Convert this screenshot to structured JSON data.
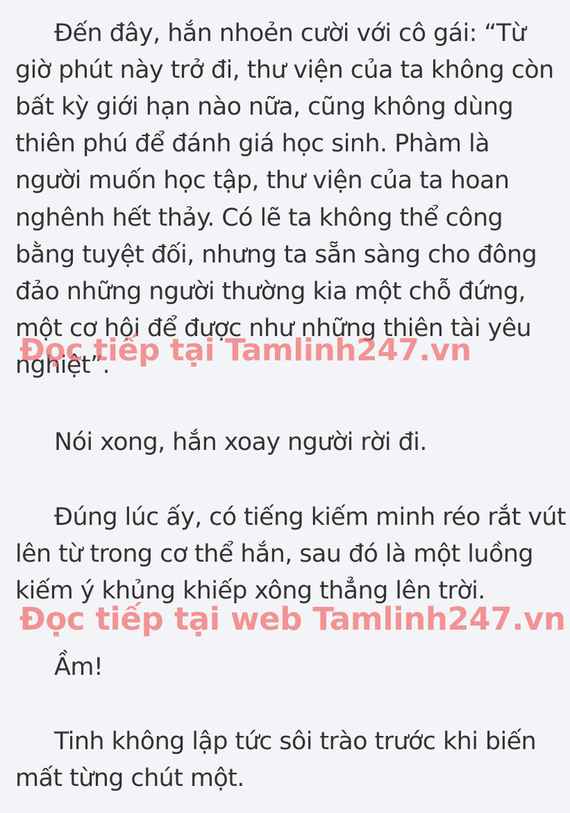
{
  "paragraphs": [
    {
      "lines": [
        "Đến đây, hắn nhoẻn cười với cô gái: “Từ",
        "giờ phút này trở đi, thư viện của ta không còn",
        "bất kỳ giới hạn nào nữa, cũng không dùng",
        "thiên phú để đánh giá học sinh. Phàm là",
        "người muốn học tập, thư viện của ta hoan",
        "nghênh hết thảy. Có lẽ ta không thể công",
        "bằng tuyệt đối, nhưng ta sẵn sàng cho đông",
        "đảo những người thường kia một chỗ đứng,",
        "một cơ hội để được như những thiên tài yêu",
        "nghiệt”."
      ]
    },
    {
      "lines": [
        "Nói xong, hắn xoay người rời đi."
      ]
    },
    {
      "lines": [
        "Đúng lúc ấy, có tiếng kiếm minh réo rắt vút",
        "lên từ trong cơ thể hắn, sau đó là một luồng",
        "kiếm ý khủng khiếp xông thẳng lên trời."
      ]
    },
    {
      "lines": [
        "Ầm!"
      ]
    },
    {
      "lines": [
        "Tinh không lập tức sôi trào trước khi biến",
        "mất từng chút một."
      ]
    }
  ],
  "watermarks": [
    "Đọc tiếp tại Tamlinh247.vn",
    "Đọc tiếp tại web Tamlinh247.vn"
  ]
}
